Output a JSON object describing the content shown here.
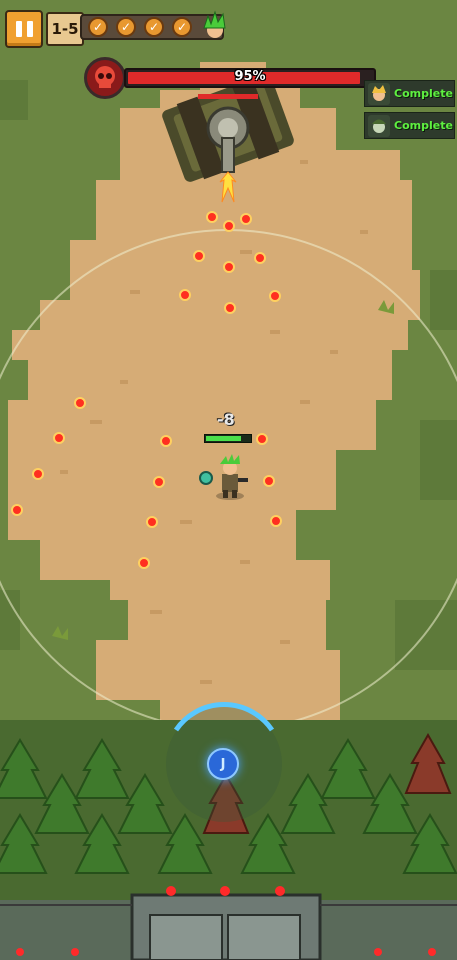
{
  "stage": {
    "label": "1-5"
  },
  "wave_progress": {
    "completed_icons": [
      "check-icon",
      "check-icon",
      "check-icon",
      "check-icon"
    ]
  },
  "boss": {
    "health_text": "95%",
    "health_fraction": 0.95,
    "color": "#e02a2a"
  },
  "objectives": [
    {
      "label": "Complete",
      "icon": "blonde-hero-portrait-icon"
    },
    {
      "label": "Complete",
      "icon": "zombie-soldier-portrait-icon"
    }
  ],
  "player": {
    "damage_text": "-8",
    "health_fraction": 0.8
  },
  "joystick": {
    "label": "J"
  }
}
